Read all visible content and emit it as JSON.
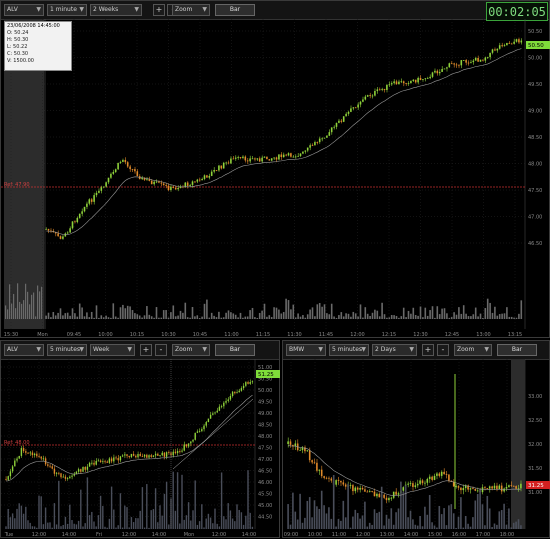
{
  "clock": "00:02:05",
  "top": {
    "toolbar": {
      "symbol": "ALV",
      "interval": "1 minute",
      "period": "2 Weeks",
      "zoom": "Zoom",
      "bar": "Bar"
    },
    "info": {
      "date": "23/06/2008 14:45:00",
      "open": "O: 50.24",
      "high": "H: 50.30",
      "low": "L: 50.22",
      "close": "C: 50.30",
      "volume": "V: 1500.00"
    },
    "axis_prices": [
      "50.50",
      "50.00",
      "49.50",
      "49.00",
      "48.50",
      "48.00",
      "47.50",
      "47.00",
      "46.50"
    ],
    "current_price": "50.50",
    "ref_label": "Ref: 47.90",
    "time_labels": [
      "15:30",
      "Mon",
      "09:45",
      "10:00",
      "10:15",
      "10:30",
      "10:45",
      "11:00",
      "11:15",
      "11:30",
      "11:45",
      "12:00",
      "12:15",
      "12:30",
      "12:45",
      "13:00",
      "13:15"
    ]
  },
  "bottom_left": {
    "toolbar": {
      "symbol": "ALV",
      "interval": "5 minutes",
      "period": "Week",
      "zoom": "Zoom",
      "bar": "Bar"
    },
    "axis_prices": [
      "51.00",
      "50.50",
      "50.00",
      "49.50",
      "49.00",
      "48.50",
      "48.00",
      "47.50",
      "47.00",
      "46.50",
      "46.00",
      "45.50",
      "45.00",
      "44.50"
    ],
    "current_price": "51.25",
    "ref_label": "Ref: 48.00",
    "time_labels": [
      "Tue",
      "12:00",
      "14:00",
      "Fri",
      "12:00",
      "14:00",
      "Mon",
      "12:00",
      "14:00"
    ]
  },
  "bottom_right": {
    "toolbar": {
      "symbol": "BMW",
      "interval": "5 minutes",
      "period": "2 Days",
      "zoom": "Zoom",
      "bar": "Bar"
    },
    "axis_prices": [
      "33.00",
      "32.50",
      "32.00",
      "31.50",
      "31.00"
    ],
    "current_price": "31.25",
    "time_labels": [
      "09:00",
      "10:00",
      "11:00",
      "12:00",
      "13:00",
      "14:00",
      "15:00",
      "16:00",
      "17:00",
      "18:00"
    ]
  }
}
